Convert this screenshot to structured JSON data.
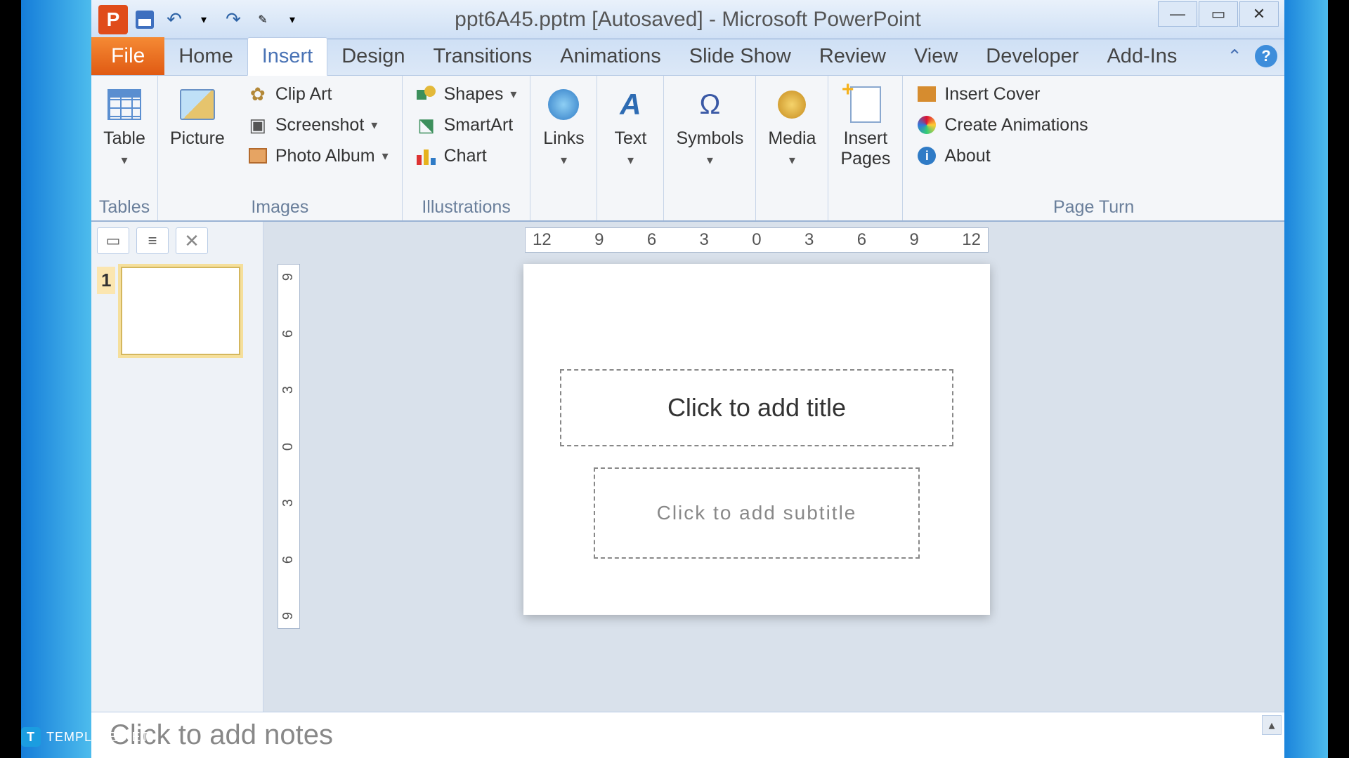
{
  "titlebar": {
    "app_letter": "P",
    "title": "ppt6A45.pptm [Autosaved] - Microsoft PowerPoint",
    "minimize": "—",
    "maximize": "▭",
    "close": "✕"
  },
  "qat": {
    "undo": "↶",
    "redo": "↷",
    "marker": "✎",
    "dropdown": "▾"
  },
  "tabs": {
    "file": "File",
    "home": "Home",
    "insert": "Insert",
    "design": "Design",
    "transitions": "Transitions",
    "animations": "Animations",
    "slideshow": "Slide Show",
    "review": "Review",
    "view": "View",
    "developer": "Developer",
    "addins": "Add-Ins",
    "collapse": "⌃",
    "help": "?"
  },
  "ribbon": {
    "tables": {
      "title": "Tables",
      "table": "Table"
    },
    "images": {
      "title": "Images",
      "picture": "Picture",
      "clipart": "Clip Art",
      "screenshot": "Screenshot",
      "photo_album": "Photo Album"
    },
    "illustrations": {
      "title": "Illustrations",
      "shapes": "Shapes",
      "smartart": "SmartArt",
      "chart": "Chart"
    },
    "links": {
      "label": "Links"
    },
    "text": {
      "label": "Text"
    },
    "symbols": {
      "label": "Symbols"
    },
    "media": {
      "label": "Media"
    },
    "pages": {
      "label_1": "Insert",
      "label_2": "Pages"
    },
    "pageturn": {
      "title": "Page Turn",
      "cover": "Insert Cover",
      "anim": "Create Animations",
      "about": "About",
      "about_i": "i"
    },
    "caret": "▾"
  },
  "panel": {
    "outline_icon": "▭",
    "slides_icon": "≡",
    "close": "✕",
    "slide_num": "1"
  },
  "ruler": {
    "h": [
      "12",
      "9",
      "6",
      "3",
      "0",
      "3",
      "6",
      "9",
      "12"
    ],
    "v": [
      "9",
      "6",
      "3",
      "0",
      "3",
      "6",
      "9"
    ]
  },
  "slide": {
    "title_ph": "Click to add title",
    "subtitle_ph": "Click to add subtitle"
  },
  "notes": {
    "placeholder": "Click to add notes",
    "scroll_up": "▴"
  },
  "watermark": {
    "icon": "T",
    "text": "TEMPLATE.NET"
  }
}
